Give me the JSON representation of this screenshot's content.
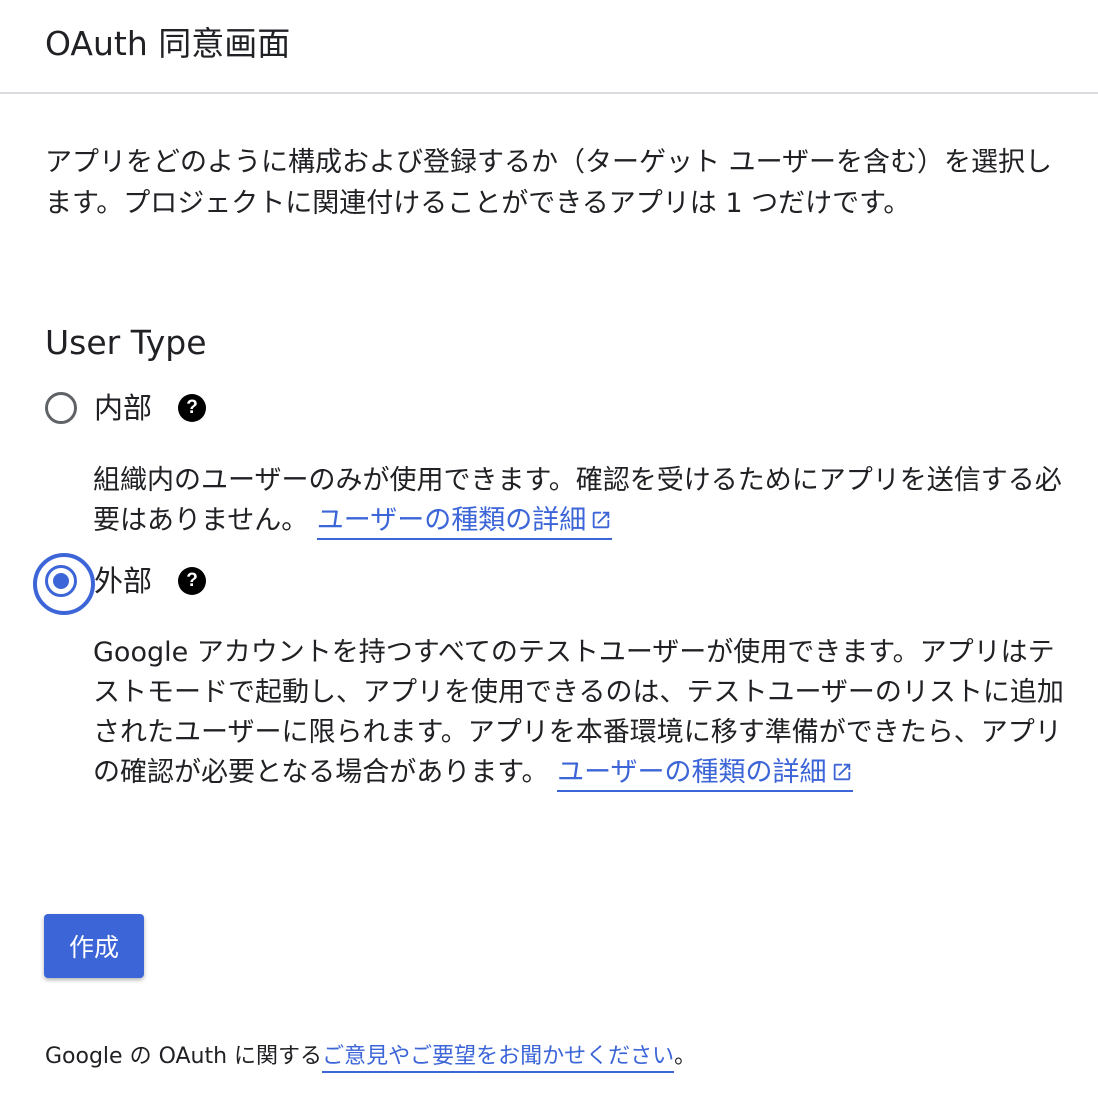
{
  "header": {
    "title": "OAuth 同意画面"
  },
  "intro": "アプリをどのように構成および登録するか（ターゲット ユーザーを含む）を選択します。プロジェクトに関連付けることができるアプリは 1 つだけです。",
  "user_type": {
    "title": "User Type",
    "options": [
      {
        "label": "内部",
        "selected": false,
        "description": "組織内のユーザーのみが使用できます。確認を受けるためにアプリを送信する必要はありません。",
        "link_text": "ユーザーの種類の詳細"
      },
      {
        "label": "外部",
        "selected": true,
        "description": "Google アカウントを持つすべてのテストユーザーが使用できます。アプリはテストモードで起動し、アプリを使用できるのは、テストユーザーのリストに追加されたユーザーに限られます。アプリを本番環境に移す準備ができたら、アプリの確認が必要となる場合があります。",
        "link_text": "ユーザーの種類の詳細"
      }
    ],
    "help_glyph": "?"
  },
  "create_button": {
    "label": "作成"
  },
  "footer": {
    "prefix": "Google の OAuth に関する",
    "link_text": "ご意見やご要望をお聞かせください",
    "suffix": "。"
  },
  "colors": {
    "accent": "#3c65d8",
    "text": "#202124",
    "divider": "#dadce0"
  },
  "icons": {
    "help": "help-circle-icon",
    "external": "open-in-new-icon"
  }
}
